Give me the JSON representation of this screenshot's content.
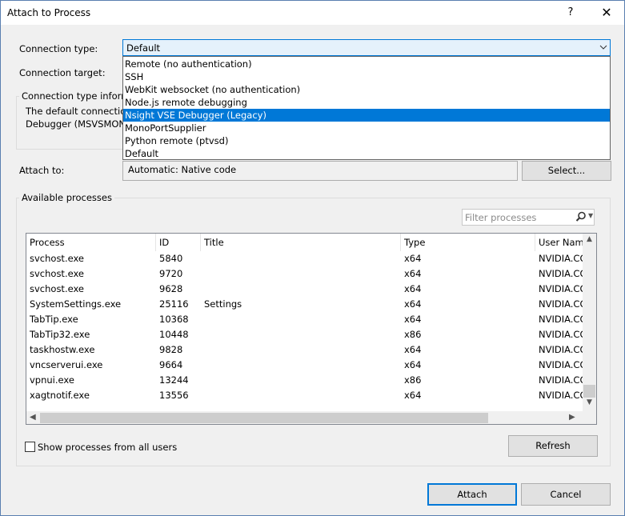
{
  "window": {
    "title": "Attach to Process",
    "help_glyph": "?",
    "close_glyph": "✕"
  },
  "connection": {
    "type_label": "Connection type:",
    "type_value": "Default",
    "target_label": "Connection target:",
    "info_title": "Connection type informa",
    "info_line1": "The default connection",
    "info_line2": "Debugger (MSVSMON.",
    "dropdown_options": [
      "Remote (no authentication)",
      "SSH",
      "WebKit websocket (no authentication)",
      "Node.js remote debugging",
      "Nsight VSE Debugger (Legacy)",
      "MonoPortSupplier",
      "Python remote (ptvsd)",
      "Default"
    ],
    "highlighted_option": "Nsight VSE Debugger (Legacy)"
  },
  "attach": {
    "label": "Attach to:",
    "value": "Automatic: Native code",
    "select_button": "Select..."
  },
  "processes": {
    "group_title": "Available processes",
    "filter_placeholder": "Filter processes",
    "columns": [
      "Process",
      "ID",
      "Title",
      "Type",
      "User Nam"
    ],
    "rows": [
      {
        "process": "svchost.exe",
        "id": "5840",
        "title": "",
        "type": "x64",
        "user": "NVIDIA.CO"
      },
      {
        "process": "svchost.exe",
        "id": "9720",
        "title": "",
        "type": "x64",
        "user": "NVIDIA.CO"
      },
      {
        "process": "svchost.exe",
        "id": "9628",
        "title": "",
        "type": "x64",
        "user": "NVIDIA.CO"
      },
      {
        "process": "SystemSettings.exe",
        "id": "25116",
        "title": "Settings",
        "type": "x64",
        "user": "NVIDIA.CO"
      },
      {
        "process": "TabTip.exe",
        "id": "10368",
        "title": "",
        "type": "x64",
        "user": "NVIDIA.CO"
      },
      {
        "process": "TabTip32.exe",
        "id": "10448",
        "title": "",
        "type": "x86",
        "user": "NVIDIA.CO"
      },
      {
        "process": "taskhostw.exe",
        "id": "9828",
        "title": "",
        "type": "x64",
        "user": "NVIDIA.CO"
      },
      {
        "process": "vncserverui.exe",
        "id": "9664",
        "title": "",
        "type": "x64",
        "user": "NVIDIA.CO"
      },
      {
        "process": "vpnui.exe",
        "id": "13244",
        "title": "",
        "type": "x86",
        "user": "NVIDIA.CO"
      },
      {
        "process": "xagtnotif.exe",
        "id": "13556",
        "title": "",
        "type": "x64",
        "user": "NVIDIA.CO"
      }
    ],
    "show_all_users_label": "Show processes from all users",
    "show_all_users_checked": false,
    "refresh_button": "Refresh"
  },
  "footer": {
    "attach_button": "Attach",
    "cancel_button": "Cancel"
  },
  "colors": {
    "accent": "#0078d7",
    "dialog_bg": "#f0f0f0"
  }
}
